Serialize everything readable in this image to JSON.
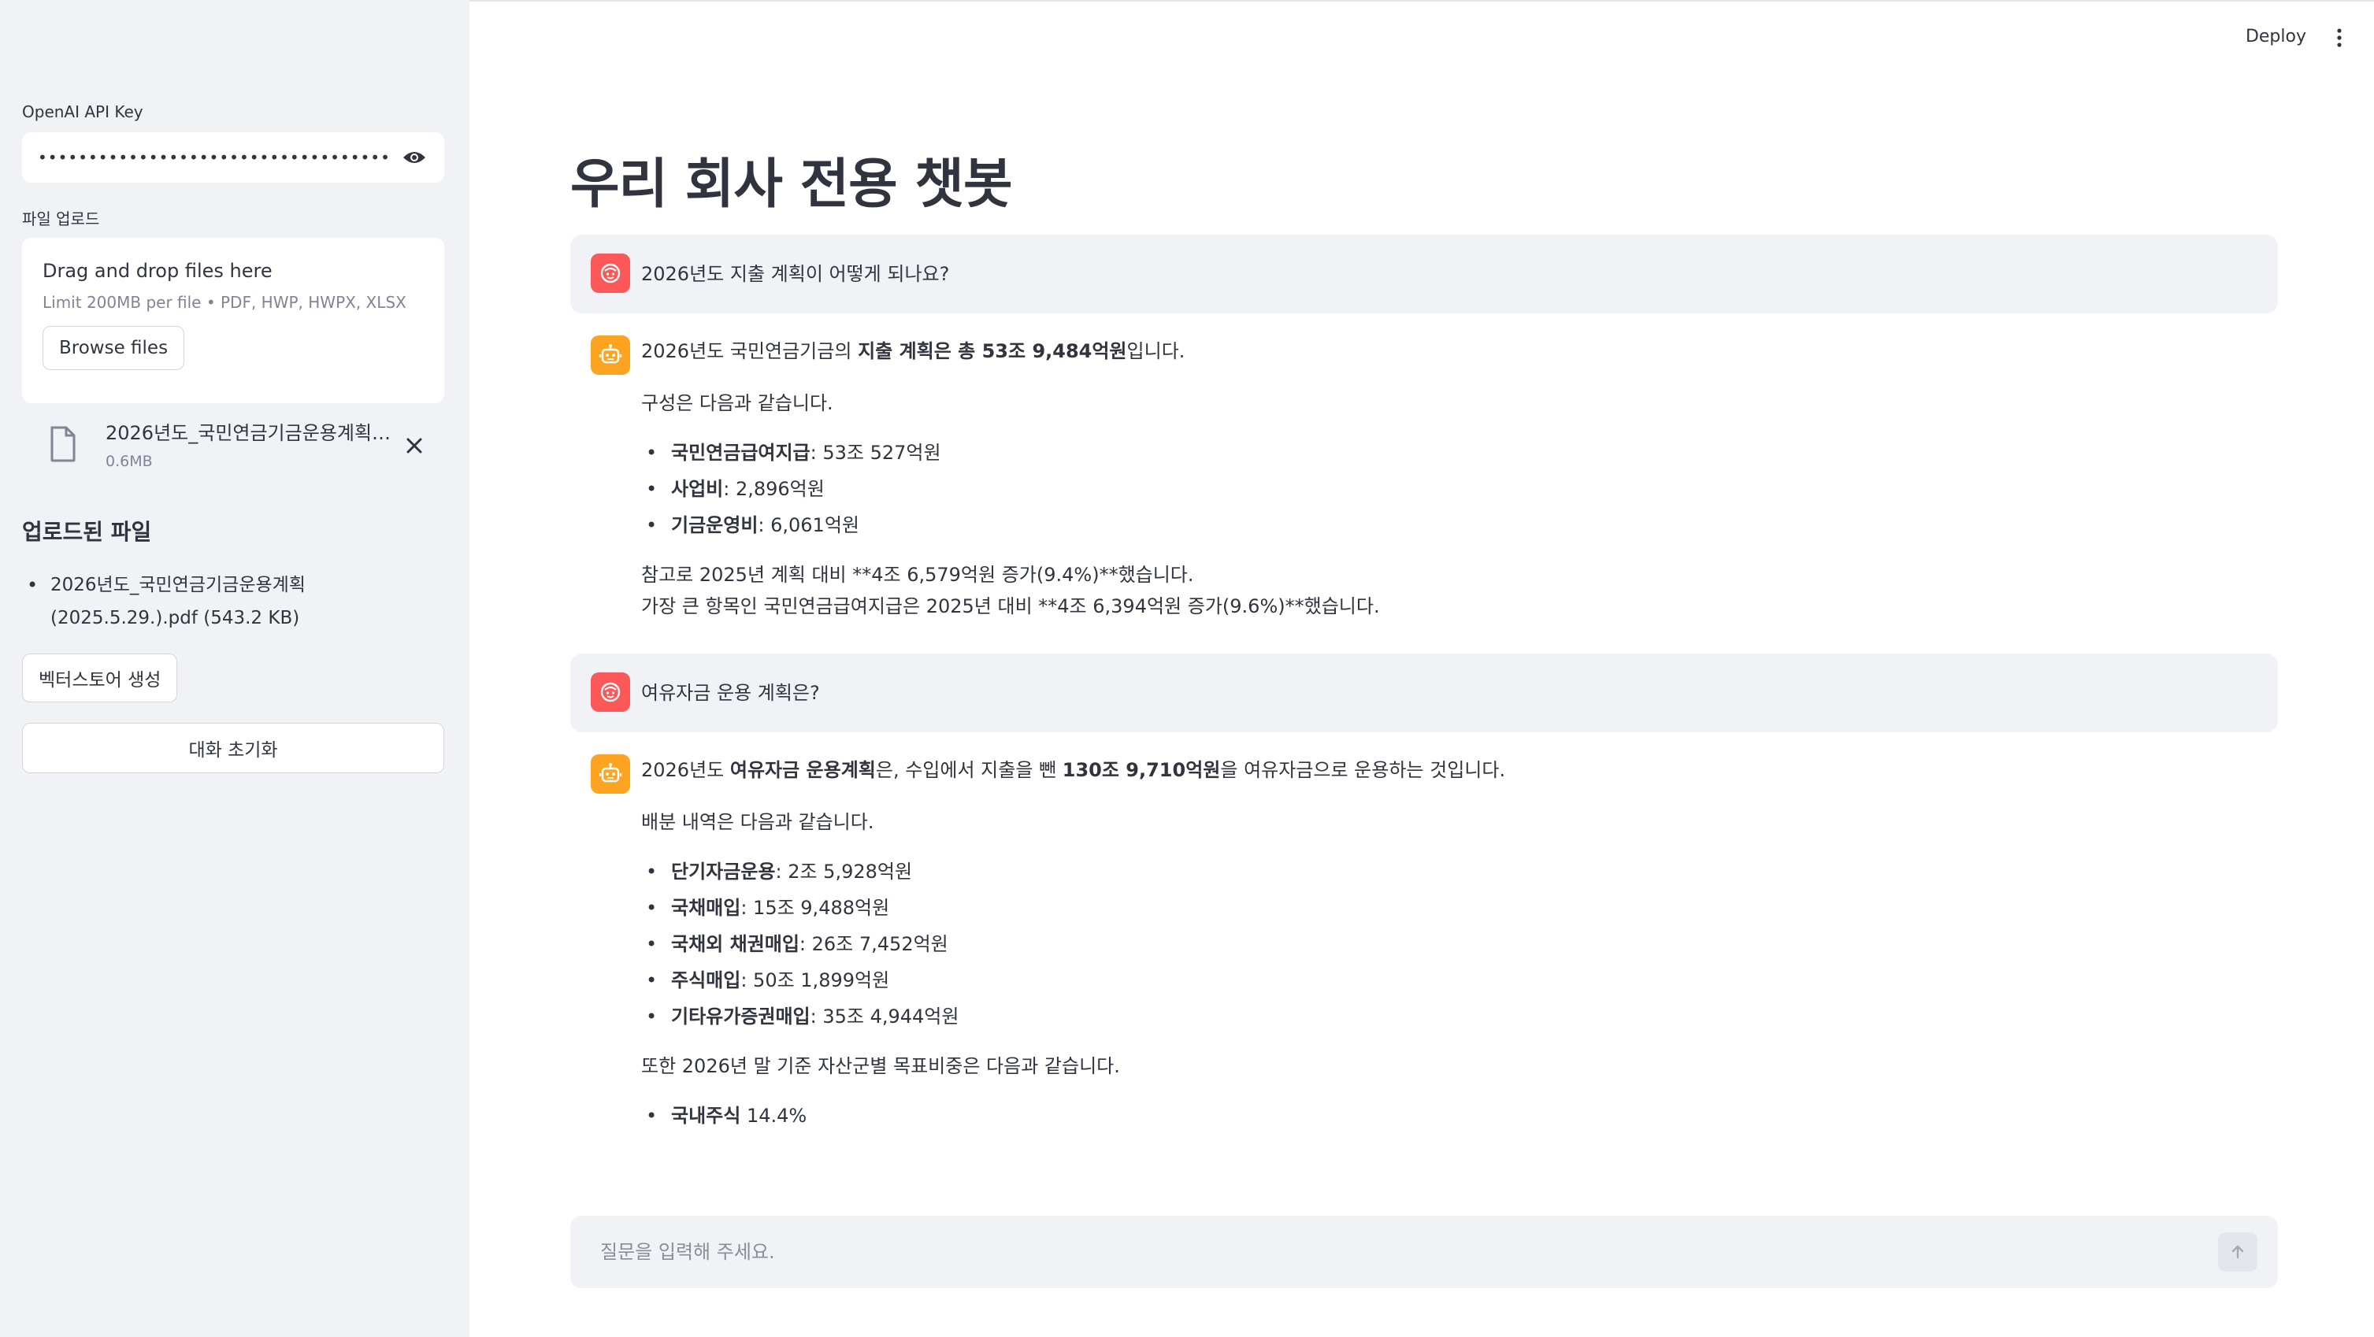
{
  "sidebar": {
    "api_key_label": "OpenAI API Key",
    "api_key_value": "••••••••••••••••••••••••••••••••••••••••••••••••••••",
    "upload_label": "파일 업로드",
    "drop_title": "Drag and drop files here",
    "drop_limit": "Limit 200MB per file • PDF, HWP, HWPX, XLSX",
    "browse_label": "Browse files",
    "attached_file_name": "2026년도_국민연금기금운용계획(2025.5.29.).pdf",
    "attached_file_size": "0.6MB",
    "uploaded_heading": "업로드된 파일",
    "uploaded_files": [
      "2026년도_국민연금기금운용계획(2025.5.29.).pdf (543.2 KB)"
    ],
    "vector_button": "벡터스토어 생성",
    "reset_button": "대화 초기화"
  },
  "header": {
    "deploy_label": "Deploy"
  },
  "main": {
    "title": "우리 회사 전용 챗봇",
    "messages": [
      {
        "role": "user",
        "text": "2026년도 지출 계획이 어떻게 되나요?"
      },
      {
        "role": "assistant",
        "intro_pre": "2026년도 국민연금기금의 ",
        "intro_bold": "지출 계획은 총 53조 9,484억원",
        "intro_post": "입니다.",
        "lead": "구성은 다음과 같습니다.",
        "items": [
          {
            "name": "국민연금급여지급",
            "value": ": 53조 527억원"
          },
          {
            "name": "사업비",
            "value": ": 2,896억원"
          },
          {
            "name": "기금운영비",
            "value": ": 6,061억원"
          }
        ],
        "note1": "참고로 2025년 계획 대비 **4조 6,579억원 증가(9.4%)**했습니다.",
        "note2": "가장 큰 항목인 국민연금급여지급은 2025년 대비 **4조 6,394억원 증가(9.6%)**했습니다."
      },
      {
        "role": "user",
        "text": "여유자금 운용 계획은?"
      },
      {
        "role": "assistant",
        "intro_a": "2026년도 ",
        "intro_b": "여유자금 운용계획",
        "intro_c": "은, 수입에서 지출을 뺀 ",
        "intro_d": "130조 9,710억원",
        "intro_e": "을 여유자금으로 운용하는 것입니다.",
        "lead": "배분 내역은 다음과 같습니다.",
        "items": [
          {
            "name": "단기자금운용",
            "value": ": 2조 5,928억원"
          },
          {
            "name": "국채매입",
            "value": ": 15조 9,488억원"
          },
          {
            "name": "국채외 채권매입",
            "value": ": 26조 7,452억원"
          },
          {
            "name": "주식매입",
            "value": ": 50조 1,899억원"
          },
          {
            "name": "기타유가증권매입",
            "value": ": 35조 4,944억원"
          }
        ],
        "lead2": "또한 2026년 말 기준 자산군별 목표비중은 다음과 같습니다.",
        "items2": [
          {
            "name": "국내주식",
            "value": " 14.4%"
          }
        ]
      }
    ]
  },
  "chat_input": {
    "placeholder": "질문을 입력해 주세요."
  },
  "colors": {
    "sidebar_bg": "#f0f2f6",
    "user_avatar": "#ff4b4b",
    "assistant_avatar": "#ffa421",
    "text": "#31333f"
  }
}
